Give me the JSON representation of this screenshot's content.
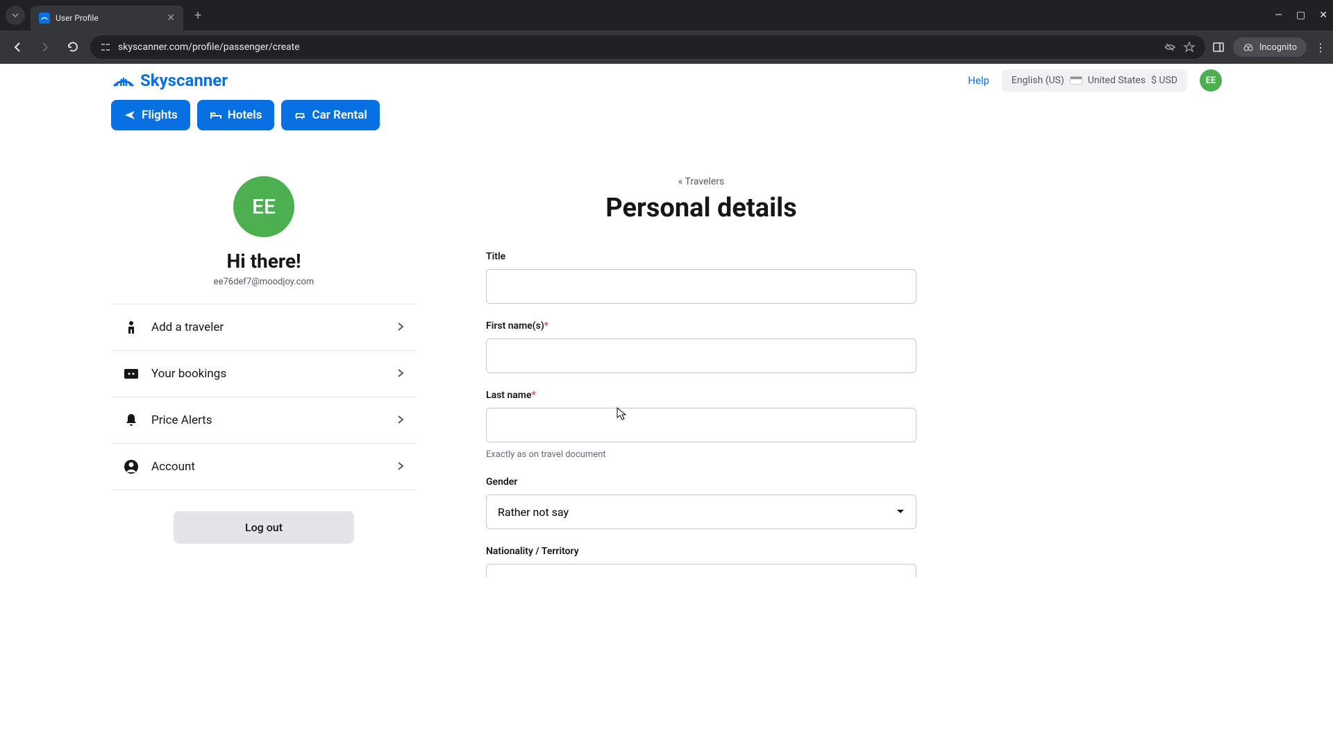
{
  "browser": {
    "tab_title": "User Profile",
    "url": "skyscanner.com/profile/passenger/create",
    "incognito_label": "Incognito"
  },
  "header": {
    "logo_text": "Skyscanner",
    "help": "Help",
    "language": "English (US)",
    "country": "United States",
    "currency": "$ USD",
    "avatar_initials": "EE"
  },
  "nav": {
    "flights": "Flights",
    "hotels": "Hotels",
    "car_rental": "Car Rental"
  },
  "sidebar": {
    "avatar_initials": "EE",
    "greeting": "Hi there!",
    "email": "ee76def7@moodjoy.com",
    "items": [
      {
        "label": "Add a traveler"
      },
      {
        "label": "Your bookings"
      },
      {
        "label": "Price Alerts"
      },
      {
        "label": "Account"
      }
    ],
    "logout": "Log out"
  },
  "content": {
    "breadcrumb": "« Travelers",
    "title": "Personal details",
    "fields": {
      "title_label": "Title",
      "first_name_label": "First name(s)",
      "last_name_label": "Last name",
      "last_name_hint": "Exactly as on travel document",
      "gender_label": "Gender",
      "gender_value": "Rather not say",
      "nationality_label": "Nationality / Territory"
    }
  }
}
